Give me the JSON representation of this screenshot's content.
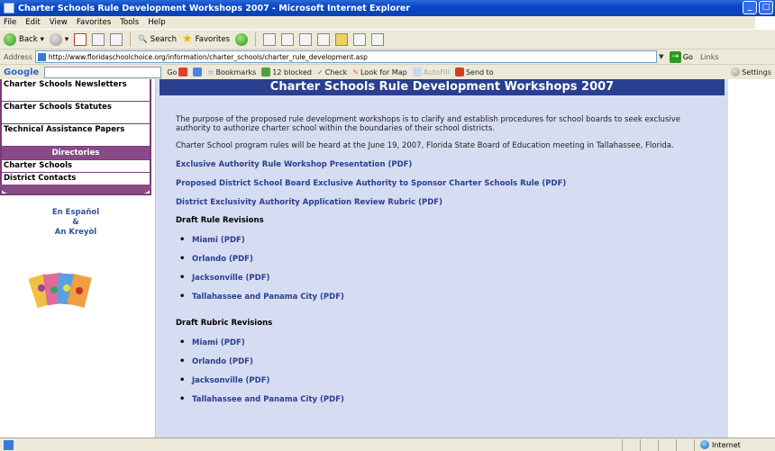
{
  "window": {
    "title": "Charter Schools Rule Development Workshops 2007 - Microsoft Internet Explorer",
    "minimize": "_",
    "maximize": "□"
  },
  "menu": [
    "File",
    "Edit",
    "View",
    "Favorites",
    "Tools",
    "Help"
  ],
  "toolbar": {
    "back": "Back",
    "search": "Search",
    "favorites": "Favorites"
  },
  "address": {
    "label": "Address",
    "url": "http://www.floridaschoolchoice.org/information/charter_schools/charter_rule_development.asp",
    "go": "Go",
    "links": "Links"
  },
  "googlebar": {
    "logo": "Google",
    "go": "Go",
    "bookmarks": "Bookmarks",
    "blocked": "12 blocked",
    "check": "Check",
    "lookfor": "Look for Map",
    "autofill": "AutoFill",
    "sendto": "Send to",
    "settings": "Settings"
  },
  "nav": {
    "items": [
      "Charter Schools Newsletters",
      "Charter Schools Statutes",
      "Technical Assistance Papers"
    ],
    "directories_header": "Directories",
    "directories": [
      "Charter Schools",
      "District Contacts"
    ],
    "lang": [
      "En Español",
      "&",
      "An Kreyòl"
    ]
  },
  "page": {
    "heading": "Charter Schools Rule Development Workshops 2007",
    "para1": "The purpose of the proposed rule development workshops is to clarify and establish procedures for school boards to seek exclusive authority to authorize charter school within the boundaries of their school districts.",
    "para2": "Charter School program rules will be heard at the June 19, 2007, Florida State Board of Education meeting in Tallahassee, Florida.",
    "links": [
      "Exclusive Authority Rule Workshop Presentation (PDF)",
      "Proposed District School Board Exclusive Authority to Sponsor Charter Schools Rule (PDF)",
      "District Exclusivity Authority Application Review Rubric (PDF)"
    ],
    "draft_rule_heading": "Draft Rule Revisions",
    "draft_rule_items": [
      "Miami (PDF)",
      "Orlando (PDF)",
      "Jacksonville (PDF)",
      "Tallahassee and Panama City (PDF)"
    ],
    "draft_rubric_heading": "Draft Rubric Revisions",
    "draft_rubric_items": [
      "Miami (PDF)",
      "Orlando (PDF)",
      "Jacksonville (PDF)",
      "Tallahassee and Panama City (PDF)"
    ]
  },
  "status": {
    "zone": "Internet"
  },
  "colors": {
    "heading_bg": "#2a3f8f",
    "content_bg": "#d6dcf2",
    "nav_border": "#7a3a78",
    "link": "#2a3f8f"
  }
}
